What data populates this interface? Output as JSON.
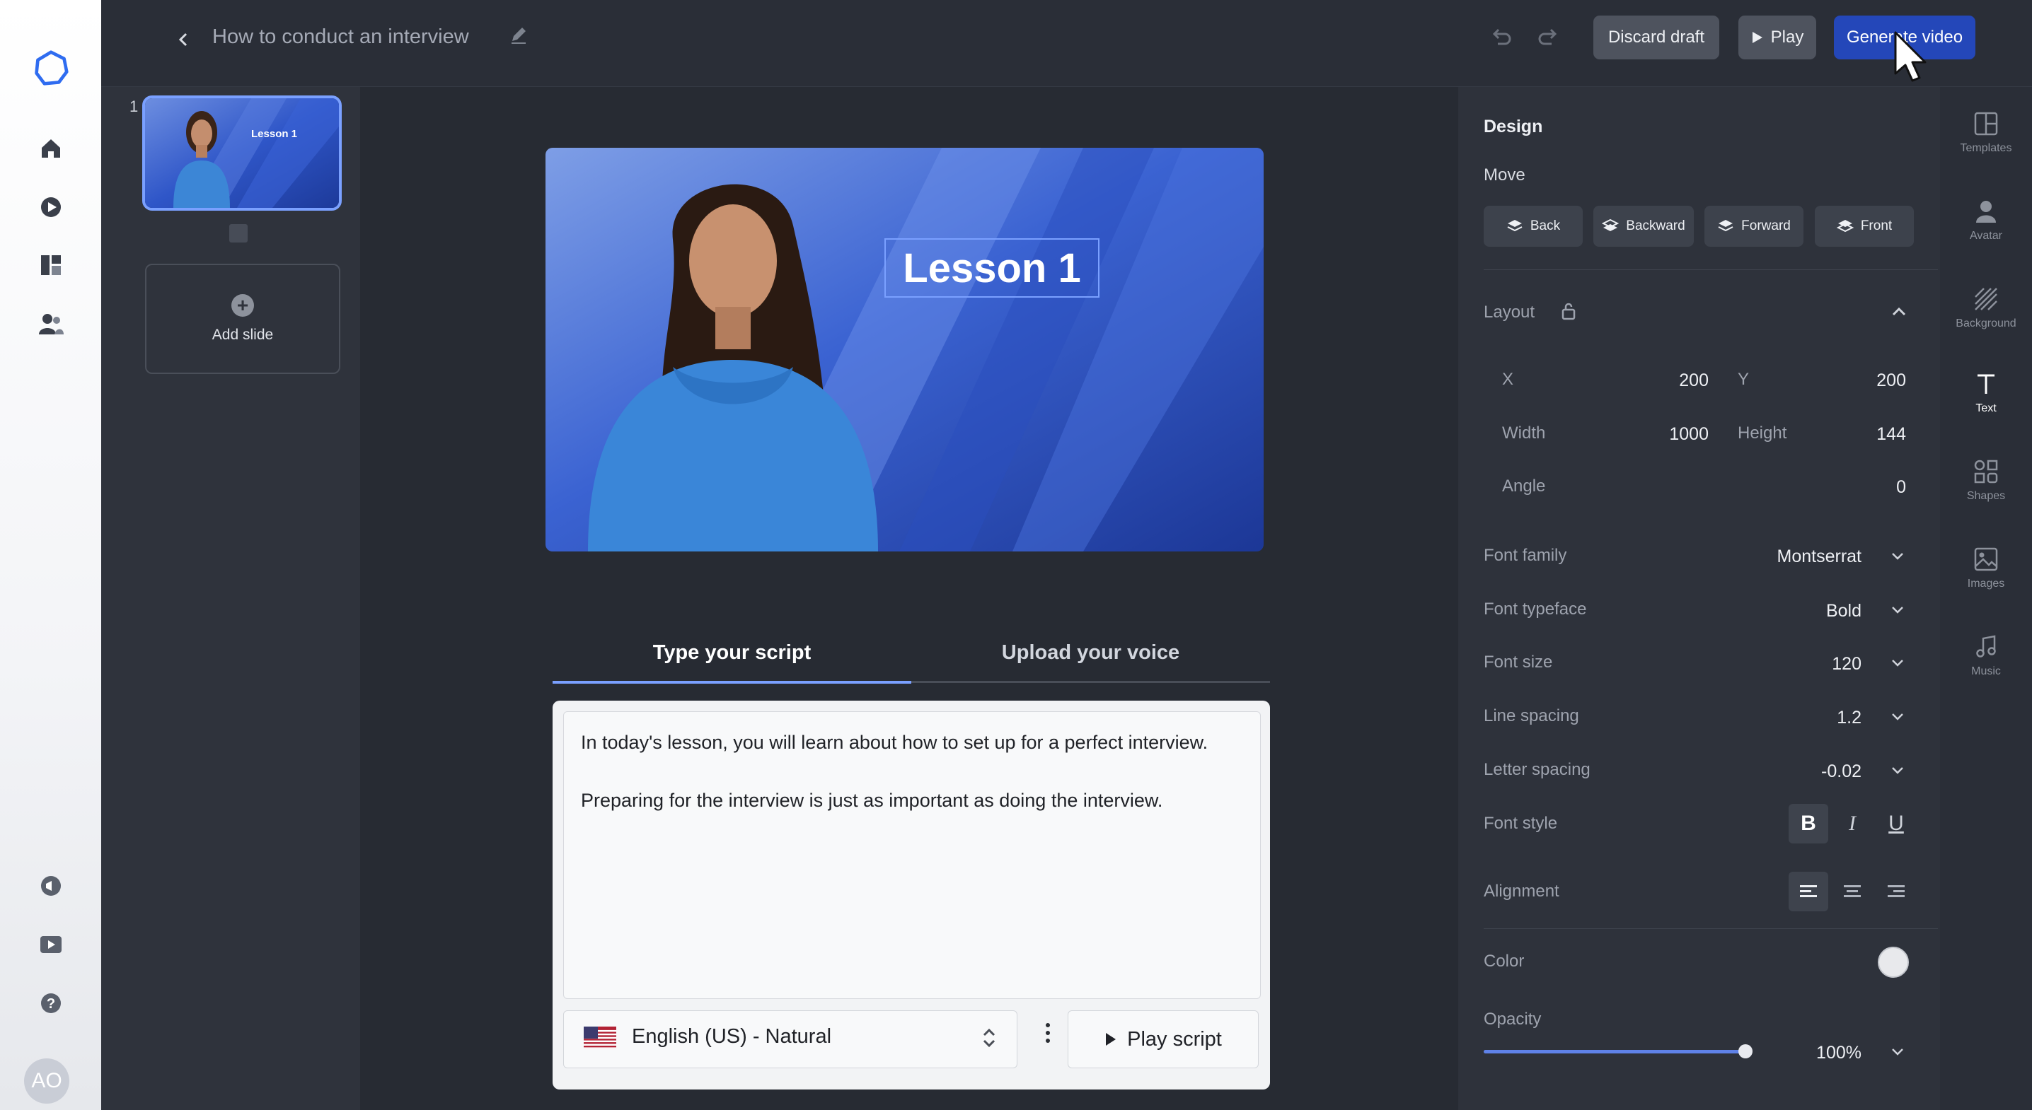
{
  "app": {
    "project_title": "How to conduct an interview"
  },
  "left_rail": {
    "avatar_initials": "AO",
    "items": [
      "home-icon",
      "video-icon",
      "templates-icon",
      "people-icon",
      "announcement-icon",
      "video-library-icon",
      "help-icon"
    ]
  },
  "toolbar": {
    "discard_label": "Discard draft",
    "play_label": "Play",
    "generate_label": "Generate video"
  },
  "slides": {
    "items": [
      {
        "number": "1",
        "thumb_text": "Lesson 1"
      }
    ],
    "add_label": "Add slide"
  },
  "canvas": {
    "heading_text": "Lesson 1"
  },
  "script": {
    "tabs": [
      {
        "label": "Type your script",
        "active": true
      },
      {
        "label": "Upload your voice",
        "active": false
      }
    ],
    "lines": [
      "In today's lesson, you will learn about how to set up for a perfect interview.",
      "Preparing for the interview is just as important as doing the interview."
    ],
    "voice": "English (US) - Natural",
    "play_script_label": "Play script"
  },
  "design": {
    "title": "Design",
    "move_label": "Move",
    "move_buttons": [
      "Back",
      "Backward",
      "Forward",
      "Front"
    ],
    "layout_label": "Layout",
    "geometry": {
      "x_label": "X",
      "x": "200",
      "y_label": "Y",
      "y": "200",
      "width_label": "Width",
      "width": "1000",
      "height_label": "Height",
      "height": "144",
      "angle_label": "Angle",
      "angle": "0"
    },
    "font_family_label": "Font family",
    "font_family": "Montserrat",
    "font_typeface_label": "Font typeface",
    "font_typeface": "Bold",
    "font_size_label": "Font size",
    "font_size": "120",
    "line_spacing_label": "Line spacing",
    "line_spacing": "1.2",
    "letter_spacing_label": "Letter spacing",
    "letter_spacing": "-0.02",
    "font_style_label": "Font style",
    "font_style_buttons": [
      "B",
      "I",
      "U"
    ],
    "alignment_label": "Alignment",
    "color_label": "Color",
    "color_value": "#e8e9ec",
    "opacity_label": "Opacity",
    "opacity": "100%",
    "opacity_fraction": 1.0
  },
  "right_rail": {
    "items": [
      {
        "label": "Templates",
        "icon": "templates-icon"
      },
      {
        "label": "Avatar",
        "icon": "avatar-icon"
      },
      {
        "label": "Background",
        "icon": "background-icon"
      },
      {
        "label": "Text",
        "icon": "text-icon",
        "active": true
      },
      {
        "label": "Shapes",
        "icon": "shapes-icon"
      },
      {
        "label": "Images",
        "icon": "images-icon"
      },
      {
        "label": "Music",
        "icon": "music-icon"
      }
    ]
  },
  "colors": {
    "accent": "#2447b9",
    "selection": "#7aa0ff",
    "panel": "#2e323b"
  }
}
